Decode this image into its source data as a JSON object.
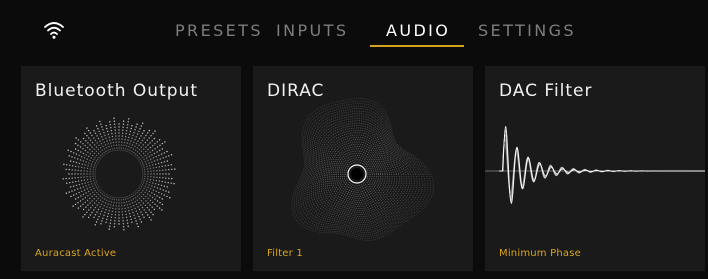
{
  "header": {
    "tabs": [
      {
        "label": "PRESETS",
        "active": false
      },
      {
        "label": "INPUTS",
        "active": false
      },
      {
        "label": "AUDIO",
        "active": true
      },
      {
        "label": "SETTINGS",
        "active": false
      }
    ],
    "wifi_icon": "wifi-icon"
  },
  "cards": [
    {
      "title": "Bluetooth Output",
      "status": "Auracast Active",
      "visual": "radial-dotted-ring"
    },
    {
      "title": "DIRAC",
      "status": "Filter 1",
      "visual": "concentric-contour-blob"
    },
    {
      "title": "DAC Filter",
      "status": "Minimum Phase",
      "visual": "impulse-response-waveform"
    }
  ],
  "colors": {
    "background": "#0b0b0b",
    "card": "#1a1a1a",
    "accent": "#d6a21e",
    "inactive_tab": "#7d7d7d",
    "active_tab": "#ffffff"
  }
}
